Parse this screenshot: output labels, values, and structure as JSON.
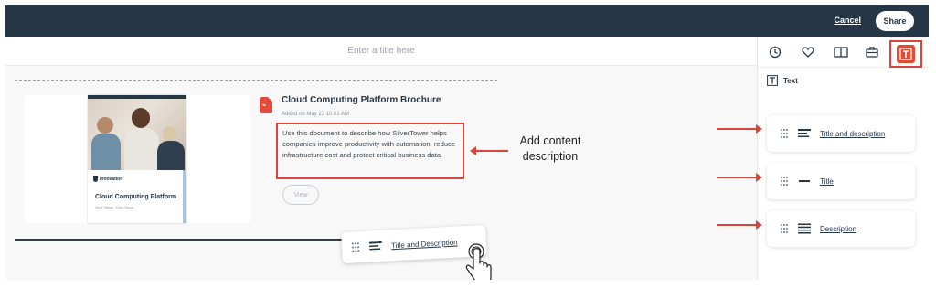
{
  "topbar": {
    "cancel_label": "Cancel",
    "share_label": "Share"
  },
  "editor": {
    "title_placeholder": "Enter a title here",
    "document": {
      "name": "Cloud Computing Platform Brochure",
      "added": "Added on May 23 10:01 AM",
      "description": "Use this document to describe how SilverTower helps companies improve productivity with automation, reduce infrastructure cost and protect critical business data.",
      "view_label": "View",
      "file_icon": "pdf-icon",
      "thumbnail": {
        "brand": "innovation",
        "title": "Cloud Computing Platform",
        "subtitle": "Your Vision. Your Cloud."
      }
    },
    "callout": {
      "line1": "Add content",
      "line2": "description"
    },
    "dragging_widget": {
      "label": "Title and Description",
      "icon": "title-description-icon"
    }
  },
  "panel": {
    "tools": [
      "clock-icon",
      "heart-icon",
      "book-icon",
      "briefcase-icon",
      "text-icon"
    ],
    "active_tool": "text-icon",
    "heading": "Text",
    "widgets": [
      {
        "label": "Title and description",
        "icon": "title-description-icon"
      },
      {
        "label": "Title",
        "icon": "title-icon"
      },
      {
        "label": "Description",
        "icon": "description-icon"
      }
    ]
  },
  "colors": {
    "topbar": "#253746",
    "accent": "#d9453d",
    "active_tool": "#e04c32",
    "text": "#253746"
  }
}
